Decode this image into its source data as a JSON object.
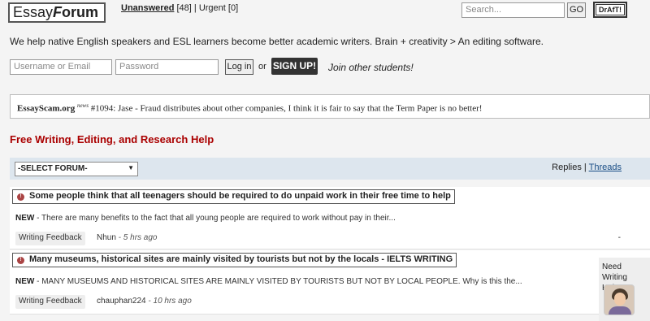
{
  "header": {
    "logo_part1": "Essay",
    "logo_part2": "F",
    "logo_part3": "orum",
    "unanswered_label": "Unanswered",
    "unanswered_count": "[48]",
    "separator": "|",
    "urgent_label": "Urgent",
    "urgent_count": "[0]",
    "search_placeholder": "Search...",
    "go_label": "GO",
    "draft_label": "DrAfT!"
  },
  "tagline": "We help native English speakers and ESL learners become better academic writers. Brain + creativity > An editing software.",
  "login": {
    "username_placeholder": "Username or Email",
    "password_placeholder": "Password",
    "login_label": "Log in",
    "or": "or",
    "signup_label": "SIGN UP!",
    "join_text": "Join other students!"
  },
  "news": {
    "site": "EssayScam.org",
    "tag": "news",
    "text": "#1094: Jase - Fraud distributes about other companies, I think it is fair to say that the Term Paper is no better!"
  },
  "section_title": "Free Writing, Editing, and Research Help",
  "forum_bar": {
    "select_value": "-SELECT FORUM-",
    "replies_label": "Replies",
    "tab_separator": "|",
    "threads_label": "Threads"
  },
  "threads": [
    {
      "title": "Some people think that all teenagers should be required to do unpaid work in their free time to help",
      "new_label": "NEW",
      "desc": " - There are many benefits to the fact that all young people are required to work without pay in their...",
      "category": "Writing Feedback",
      "author": "Nhun",
      "time": " - 5 hrs ago",
      "dash": "-"
    },
    {
      "title": "Many museums, historical sites are mainly visited by tourists but not by the locals - IELTS WRITING",
      "new_label": "NEW",
      "desc": " - MANY MUSEUMS AND HISTORICAL SITES ARE MAINLY VISITED BY TOURISTS BUT NOT BY LOCAL PEOPLE. Why is this the...",
      "category": "Writing Feedback",
      "author": "chauphan224",
      "time": " - 10 hrs ago"
    }
  ],
  "help_widget": {
    "line1": "Need",
    "line2": "Writing Help?"
  }
}
